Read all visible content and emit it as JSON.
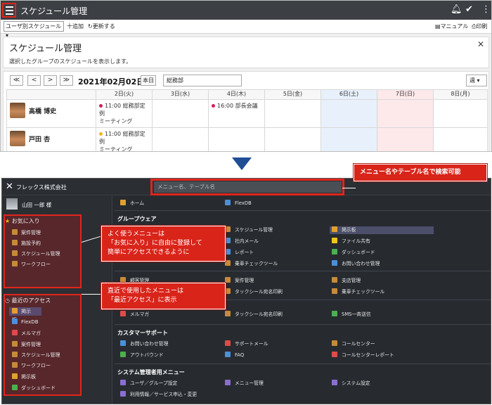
{
  "top": {
    "app_title": "スケジュール管理",
    "toolbar": {
      "view_select": "ユーザ別スケジュール",
      "add": "十追加",
      "refresh": "更新する",
      "manual": "マニュアル",
      "print": "印刷"
    },
    "panel": {
      "title": "スケジュール管理",
      "description": "選択したグループのスケジュールを表示します。"
    },
    "nav": {
      "first": "≪",
      "prev": "<",
      "next": ">",
      "last": "≫",
      "current_date": "2021年02月02日",
      "today": "本日",
      "group": "総務部",
      "range": "週"
    },
    "days": [
      "2日(火)",
      "3日(水)",
      "4日(木)",
      "5日(金)",
      "6日(土)",
      "7日(日)",
      "8日(月)"
    ],
    "rows": [
      {
        "name": "高橋 博史",
        "tue": {
          "time": "11:00 総務部定例",
          "text": "ミーティング",
          "color": "#d81b60"
        },
        "thu": {
          "time": "16:00 部長会議",
          "color": "#d81b60"
        }
      },
      {
        "name": "戸田 杏",
        "tue": {
          "time": "11:00 総務部定例",
          "text": "ミーティング",
          "color": "#f5b800"
        }
      }
    ]
  },
  "bottom": {
    "company": "フレックス株式会社",
    "search_placeholder": "メニュー名、テーブル名",
    "user": "山田 一郎 様",
    "favorites": {
      "title": "お気に入り",
      "items": [
        "案件管理",
        "施設予約",
        "スケジュール管理",
        "ワークフロー"
      ]
    },
    "recent": {
      "title": "最近のアクセス",
      "items": [
        "掲示板",
        "FlexDB",
        "メルマガ",
        "案件管理",
        "スケジュール管理",
        "ワークフロー",
        "掲示板",
        "ダッシュボード"
      ]
    },
    "home": {
      "home": "ホーム",
      "flexdb": "FlexDB"
    },
    "groupware": {
      "title": "グループウェア",
      "col1": [
        "スケジュール管理",
        "社内メール",
        "レポート",
        "乗車チェックツール"
      ],
      "col2": [
        "掲示板",
        "ファイル共有",
        "ダッシュボード",
        "お問い合わせ管理"
      ]
    },
    "sales": {
      "col0": [
        "顧客管理"
      ],
      "col1": [
        "案件管理",
        "タックシール宛名印刷"
      ],
      "col2": [
        "支店管理",
        "乗車チェックツール"
      ]
    },
    "mail": {
      "col0": "メルマガ",
      "col1": "タックシール宛名印刷",
      "col2": "SMS一斉送信"
    },
    "support": {
      "title": "カスタマーサポート",
      "col0": [
        "お問い合わせ管理",
        "アウトバウンド"
      ],
      "col1": [
        "サポートメール",
        "FAQ"
      ],
      "col2": [
        "コールセンター",
        "コールセンターレポート"
      ]
    },
    "admin": {
      "title": "システム管理者用メニュー",
      "col0": [
        "ユーザ／グループ設定",
        "利用情報／サービス申込・変更"
      ],
      "col1": "メニュー管理",
      "col2": "システム設定"
    },
    "callouts": {
      "search": "メニュー名やテーブル名で検索可能",
      "favorites": [
        "よく使うメニューは",
        "「お気に入り」に自由に登録して",
        "簡単にアクセスできるように"
      ],
      "recent": [
        "直近で使用したメニューは",
        "「最近アクセス」に表示"
      ]
    }
  },
  "colors": {
    "accent_red": "#e0251b",
    "arrow_blue": "#1f4e96",
    "dark_bg": "#272b30"
  }
}
